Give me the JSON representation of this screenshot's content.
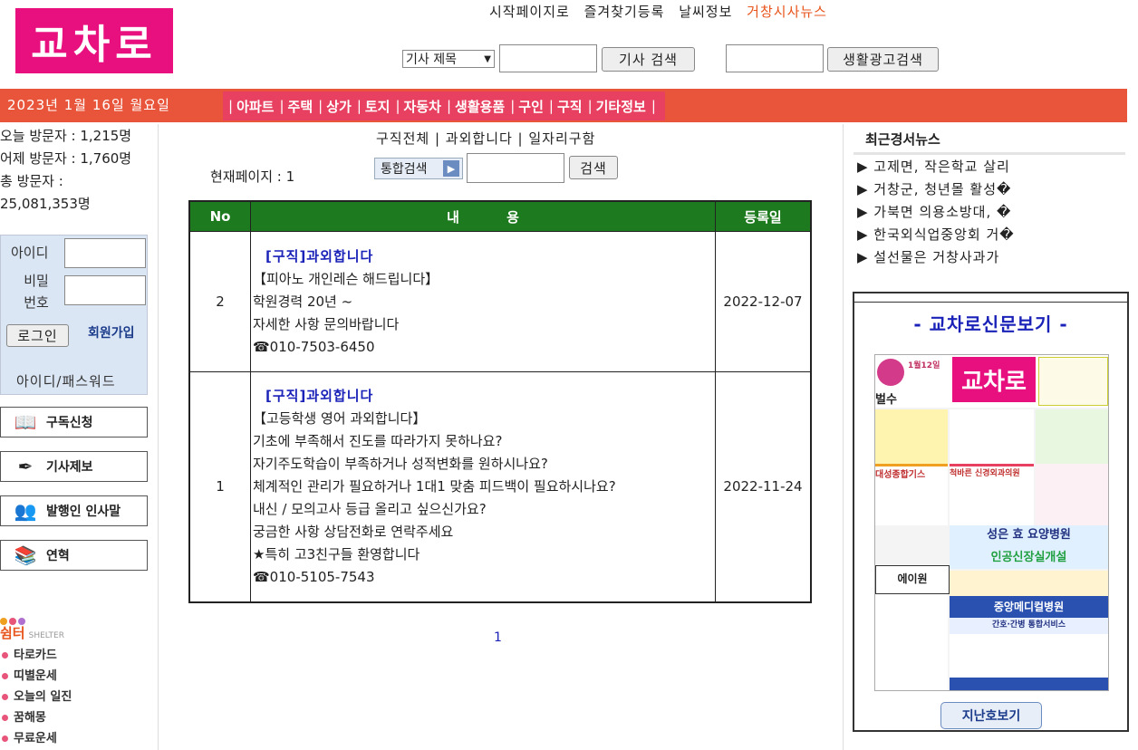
{
  "header": {
    "logo_text": "교차로",
    "top_links": [
      "시작페이지로",
      "즐겨찾기등록",
      "날씨정보"
    ],
    "news_link": "거창시사뉴스",
    "search_select": "기사 제목",
    "search_button": "기사 검색",
    "ad_search_button": "생활광고검색"
  },
  "nav": {
    "date": "2023년 1월 16일 월요일",
    "categories": [
      "아파트",
      "주택",
      "상가",
      "토지",
      "자동차",
      "생활용품",
      "구인",
      "구직",
      "기타정보"
    ]
  },
  "left": {
    "visits": {
      "today": "오늘 방문자 : 1,215명",
      "yesterday": "어제 방문자 : 1,760명",
      "total": "총 방문자 : 25,081,353명"
    },
    "login": {
      "id_label": "아이디",
      "pw_label": "비밀번호",
      "login_button": "로그인",
      "join_link": "회원가입",
      "find_link": "아이디/패스워드"
    },
    "menu": [
      "구독신청",
      "기사제보",
      "발행인 인사말",
      "연혁"
    ],
    "shelter": {
      "title": "쉼터",
      "subtitle": "SHELTER",
      "items": [
        "타로카드",
        "띠별운세",
        "오늘의 일진",
        "꿈해몽",
        "무료운세"
      ]
    }
  },
  "center": {
    "tabs": "구직전체 | 과외합니다 | 일자리구함",
    "current_page": "현재페이지 : 1",
    "search_select": "통합검색",
    "search_button": "검색",
    "table": {
      "headers": [
        "No",
        "내          용",
        "등록일"
      ],
      "rows": [
        {
          "no": "2",
          "title": "[구직]과외합니다",
          "lines": [
            "【피아노 개인레슨 해드립니다】",
            "학원경력 20년 ~",
            "자세한 사항 문의바랍니다",
            "☎010-7503-6450"
          ],
          "date": "2022-12-07"
        },
        {
          "no": "1",
          "title": "[구직]과외합니다",
          "lines": [
            "【고등학생 영어 과외합니다】",
            "기초에 부족해서 진도를 따라가지 못하나요?",
            "자기주도학습이 부족하거나 성적변화를 원하시나요?",
            "체계적인 관리가 필요하거나 1대1 맞춤 피드백이 필요하시나요?",
            "내신 / 모의고사 등급 올리고 싶으신가요?",
            "궁금한 사항 상담전화로 연락주세요",
            "★특히 고3친구들 환영합니다",
            "☎010-5105-7543"
          ],
          "date": "2022-11-24"
        }
      ]
    },
    "pagination": "1"
  },
  "right": {
    "news_title": "최근경서뉴스",
    "news": [
      "▶ 고제면, 작은학교 살리",
      "▶ 거창군, 청년몰 활성�",
      "▶ 가북면 의용소방대, �",
      "▶ 한국외식업중앙회 거�",
      "▶ 설선물은 거창사과가"
    ],
    "paper_title": "- 교차로신문보기 -",
    "back_issue_button": "지난호보기",
    "paper": {
      "logo": "교차로",
      "date": "1월12일",
      "ads": [
        "벌수",
        "대성종합기스",
        "척바른 신경외과의원",
        "성은 효 요양병원",
        "인공신장실개설",
        "에이원",
        "중앙메디컬병원",
        "간호·간병 통합서비스"
      ]
    }
  },
  "colors": {
    "logo_bg": "#e8107f",
    "nav_bar": "#e8553a",
    "nav_cats": "#e84060",
    "table_header": "#1e7a1e",
    "title_blue": "#1a22b8"
  }
}
